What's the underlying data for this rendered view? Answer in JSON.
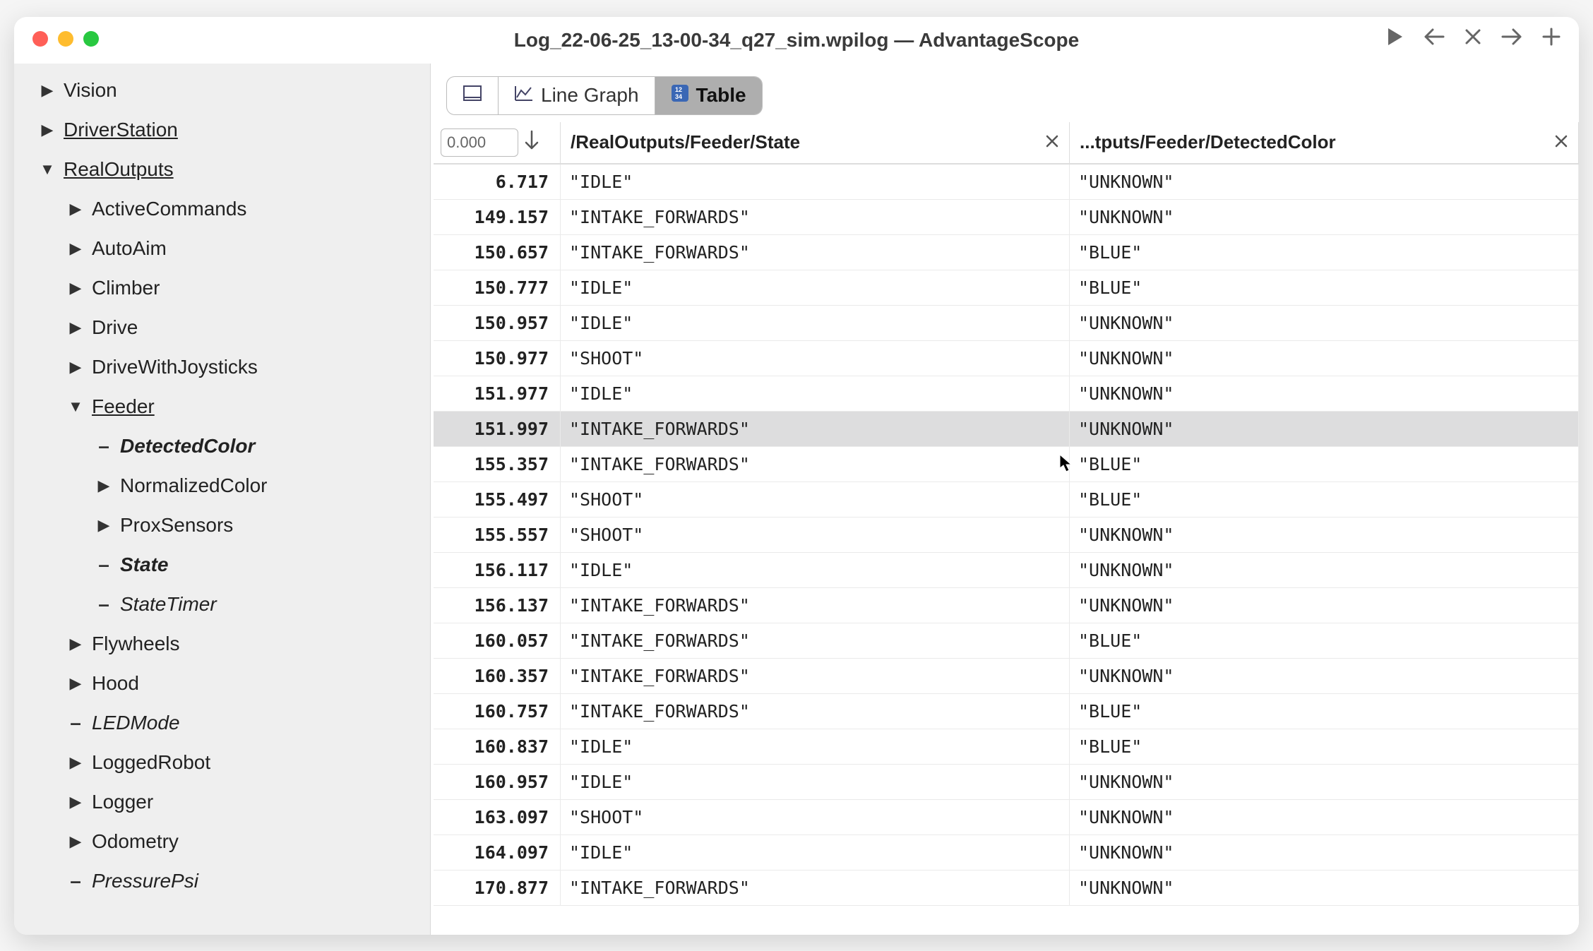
{
  "window": {
    "title": "Log_22-06-25_13-00-34_q27_sim.wpilog — AdvantageScope"
  },
  "tabs": [
    {
      "id": "odometry",
      "icon": "⏍",
      "label": ""
    },
    {
      "id": "linegraph",
      "icon": "📈",
      "label": "Line Graph"
    },
    {
      "id": "table",
      "icon": "🔢",
      "label": "Table",
      "active": true
    }
  ],
  "sidebar": [
    {
      "depth": 0,
      "type": "branch",
      "expanded": false,
      "label": "Vision"
    },
    {
      "depth": 0,
      "type": "branch",
      "expanded": false,
      "label": "DriverStation",
      "underline": true
    },
    {
      "depth": 0,
      "type": "branch",
      "expanded": true,
      "label": "RealOutputs",
      "underline": true
    },
    {
      "depth": 1,
      "type": "branch",
      "expanded": false,
      "label": "ActiveCommands"
    },
    {
      "depth": 1,
      "type": "branch",
      "expanded": false,
      "label": "AutoAim"
    },
    {
      "depth": 1,
      "type": "branch",
      "expanded": false,
      "label": "Climber"
    },
    {
      "depth": 1,
      "type": "branch",
      "expanded": false,
      "label": "Drive"
    },
    {
      "depth": 1,
      "type": "branch",
      "expanded": false,
      "label": "DriveWithJoysticks"
    },
    {
      "depth": 1,
      "type": "branch",
      "expanded": true,
      "label": "Feeder"
    },
    {
      "depth": 2,
      "type": "leaf",
      "label": "DetectedColor",
      "selected": true
    },
    {
      "depth": 2,
      "type": "branch",
      "expanded": false,
      "label": "NormalizedColor"
    },
    {
      "depth": 2,
      "type": "branch",
      "expanded": false,
      "label": "ProxSensors"
    },
    {
      "depth": 2,
      "type": "leaf",
      "label": "State",
      "selected": true
    },
    {
      "depth": 2,
      "type": "leaf",
      "label": "StateTimer"
    },
    {
      "depth": 1,
      "type": "branch",
      "expanded": false,
      "label": "Flywheels"
    },
    {
      "depth": 1,
      "type": "branch",
      "expanded": false,
      "label": "Hood"
    },
    {
      "depth": 1,
      "type": "leaf",
      "label": "LEDMode"
    },
    {
      "depth": 1,
      "type": "branch",
      "expanded": false,
      "label": "LoggedRobot"
    },
    {
      "depth": 1,
      "type": "branch",
      "expanded": false,
      "label": "Logger"
    },
    {
      "depth": 1,
      "type": "branch",
      "expanded": false,
      "label": "Odometry"
    },
    {
      "depth": 1,
      "type": "leaf",
      "label": "PressurePsi"
    }
  ],
  "table": {
    "time_input": "0.000",
    "columns": [
      {
        "label": "/RealOutputs/Feeder/State"
      },
      {
        "label": "...tputs/Feeder/DetectedColor"
      }
    ],
    "highlightedRow": 7,
    "rows": [
      {
        "t": "6.717",
        "v": [
          "\"IDLE\"",
          "\"UNKNOWN\""
        ]
      },
      {
        "t": "149.157",
        "v": [
          "\"INTAKE_FORWARDS\"",
          "\"UNKNOWN\""
        ]
      },
      {
        "t": "150.657",
        "v": [
          "\"INTAKE_FORWARDS\"",
          "\"BLUE\""
        ]
      },
      {
        "t": "150.777",
        "v": [
          "\"IDLE\"",
          "\"BLUE\""
        ]
      },
      {
        "t": "150.957",
        "v": [
          "\"IDLE\"",
          "\"UNKNOWN\""
        ]
      },
      {
        "t": "150.977",
        "v": [
          "\"SHOOT\"",
          "\"UNKNOWN\""
        ]
      },
      {
        "t": "151.977",
        "v": [
          "\"IDLE\"",
          "\"UNKNOWN\""
        ]
      },
      {
        "t": "151.997",
        "v": [
          "\"INTAKE_FORWARDS\"",
          "\"UNKNOWN\""
        ]
      },
      {
        "t": "155.357",
        "v": [
          "\"INTAKE_FORWARDS\"",
          "\"BLUE\""
        ]
      },
      {
        "t": "155.497",
        "v": [
          "\"SHOOT\"",
          "\"BLUE\""
        ]
      },
      {
        "t": "155.557",
        "v": [
          "\"SHOOT\"",
          "\"UNKNOWN\""
        ]
      },
      {
        "t": "156.117",
        "v": [
          "\"IDLE\"",
          "\"UNKNOWN\""
        ]
      },
      {
        "t": "156.137",
        "v": [
          "\"INTAKE_FORWARDS\"",
          "\"UNKNOWN\""
        ]
      },
      {
        "t": "160.057",
        "v": [
          "\"INTAKE_FORWARDS\"",
          "\"BLUE\""
        ]
      },
      {
        "t": "160.357",
        "v": [
          "\"INTAKE_FORWARDS\"",
          "\"UNKNOWN\""
        ]
      },
      {
        "t": "160.757",
        "v": [
          "\"INTAKE_FORWARDS\"",
          "\"BLUE\""
        ]
      },
      {
        "t": "160.837",
        "v": [
          "\"IDLE\"",
          "\"BLUE\""
        ]
      },
      {
        "t": "160.957",
        "v": [
          "\"IDLE\"",
          "\"UNKNOWN\""
        ]
      },
      {
        "t": "163.097",
        "v": [
          "\"SHOOT\"",
          "\"UNKNOWN\""
        ]
      },
      {
        "t": "164.097",
        "v": [
          "\"IDLE\"",
          "\"UNKNOWN\""
        ]
      },
      {
        "t": "170.877",
        "v": [
          "\"INTAKE_FORWARDS\"",
          "\"UNKNOWN\""
        ]
      }
    ]
  }
}
